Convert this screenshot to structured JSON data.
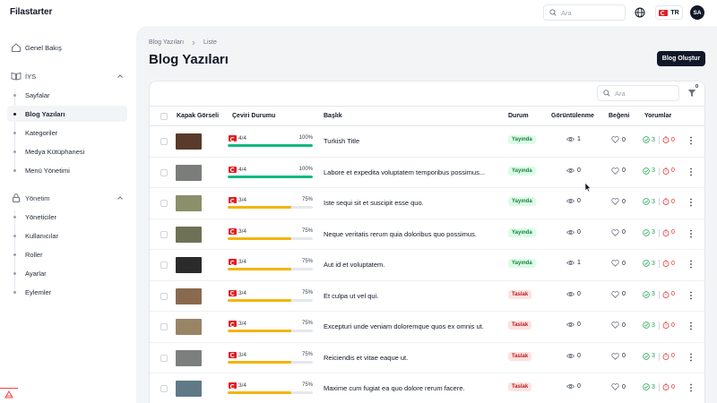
{
  "app": {
    "brand": "Filastarter"
  },
  "topbar": {
    "search_placeholder": "Ara",
    "lang_label": "TR",
    "avatar_initials": "SA"
  },
  "sidebar": {
    "overview": "Genel Bakış",
    "groups": [
      {
        "label": "İYS",
        "items": [
          "Sayfalar",
          "Blog Yazıları",
          "Kategoriler",
          "Medya Kütüphanesi",
          "Menü Yönetimi"
        ],
        "active_index": 1
      },
      {
        "label": "Yönetim",
        "items": [
          "Yöneticiler",
          "Kullanıcılar",
          "Roller",
          "Ayarlar",
          "Eylemler"
        ]
      }
    ]
  },
  "breadcrumb": [
    "Blog Yazıları",
    "Liste"
  ],
  "page_title": "Blog Yazıları",
  "create_button": "Blog Oluştur",
  "table": {
    "search_placeholder": "Ara",
    "filter_count": "0",
    "columns": [
      "Kapak Görseli",
      "Çeviri Durumu",
      "Başlık",
      "Durum",
      "Görüntülenme",
      "Beğeni",
      "Yorumlar"
    ],
    "status_colors": {
      "complete": "#10b981",
      "partial": "#f5b40b"
    },
    "rows": [
      {
        "thumb": "#5a3a2a",
        "translation": "4/4",
        "progress": 1.0,
        "pct": "100%",
        "title": "Turkish Title",
        "status": "Yayında",
        "status_type": "pub",
        "views": "1",
        "likes": "0",
        "approved": "3",
        "pending": "0"
      },
      {
        "thumb": "#7a7d7a",
        "translation": "4/4",
        "progress": 1.0,
        "pct": "100%",
        "title": "Labore et expedita voluptatem temporibus possimus...",
        "status": "Yayında",
        "status_type": "pub",
        "views": "0",
        "likes": "0",
        "approved": "3",
        "pending": "0"
      },
      {
        "thumb": "#8b8f6a",
        "translation": "3/4",
        "progress": 0.75,
        "pct": "75%",
        "title": "Iste sequi sit et suscipit esse quo.",
        "status": "Yayında",
        "status_type": "pub",
        "views": "0",
        "likes": "0",
        "approved": "3",
        "pending": "0"
      },
      {
        "thumb": "#6f7156",
        "translation": "3/4",
        "progress": 0.75,
        "pct": "75%",
        "title": "Neque veritatis rerum quia doloribus quo possimus.",
        "status": "Yayında",
        "status_type": "pub",
        "views": "0",
        "likes": "0",
        "approved": "3",
        "pending": "0"
      },
      {
        "thumb": "#2b2b2b",
        "translation": "3/4",
        "progress": 0.75,
        "pct": "75%",
        "title": "Aut id et voluptatem.",
        "status": "Yayında",
        "status_type": "pub",
        "views": "1",
        "likes": "0",
        "approved": "3",
        "pending": "0"
      },
      {
        "thumb": "#8a6a4f",
        "translation": "3/4",
        "progress": 0.75,
        "pct": "75%",
        "title": "Et culpa ut vel qui.",
        "status": "Taslak",
        "status_type": "draft",
        "views": "0",
        "likes": "0",
        "approved": "3",
        "pending": "0"
      },
      {
        "thumb": "#9a8466",
        "translation": "3/4",
        "progress": 0.75,
        "pct": "75%",
        "title": "Excepturi unde veniam doloremque quos ex omnis ut.",
        "status": "Taslak",
        "status_type": "draft",
        "views": "0",
        "likes": "0",
        "approved": "3",
        "pending": "0"
      },
      {
        "thumb": "#7d7f7e",
        "translation": "3/4",
        "progress": 0.75,
        "pct": "75%",
        "title": "Reiciendis et vitae eaque ut.",
        "status": "Taslak",
        "status_type": "draft",
        "views": "0",
        "likes": "0",
        "approved": "3",
        "pending": "0"
      },
      {
        "thumb": "#5f7a86",
        "translation": "3/4",
        "progress": 0.75,
        "pct": "75%",
        "title": "Maxime cum fugiat ea quo dolore rerum facere.",
        "status": "Taslak",
        "status_type": "draft",
        "views": "0",
        "likes": "0",
        "approved": "3",
        "pending": "0"
      }
    ]
  }
}
